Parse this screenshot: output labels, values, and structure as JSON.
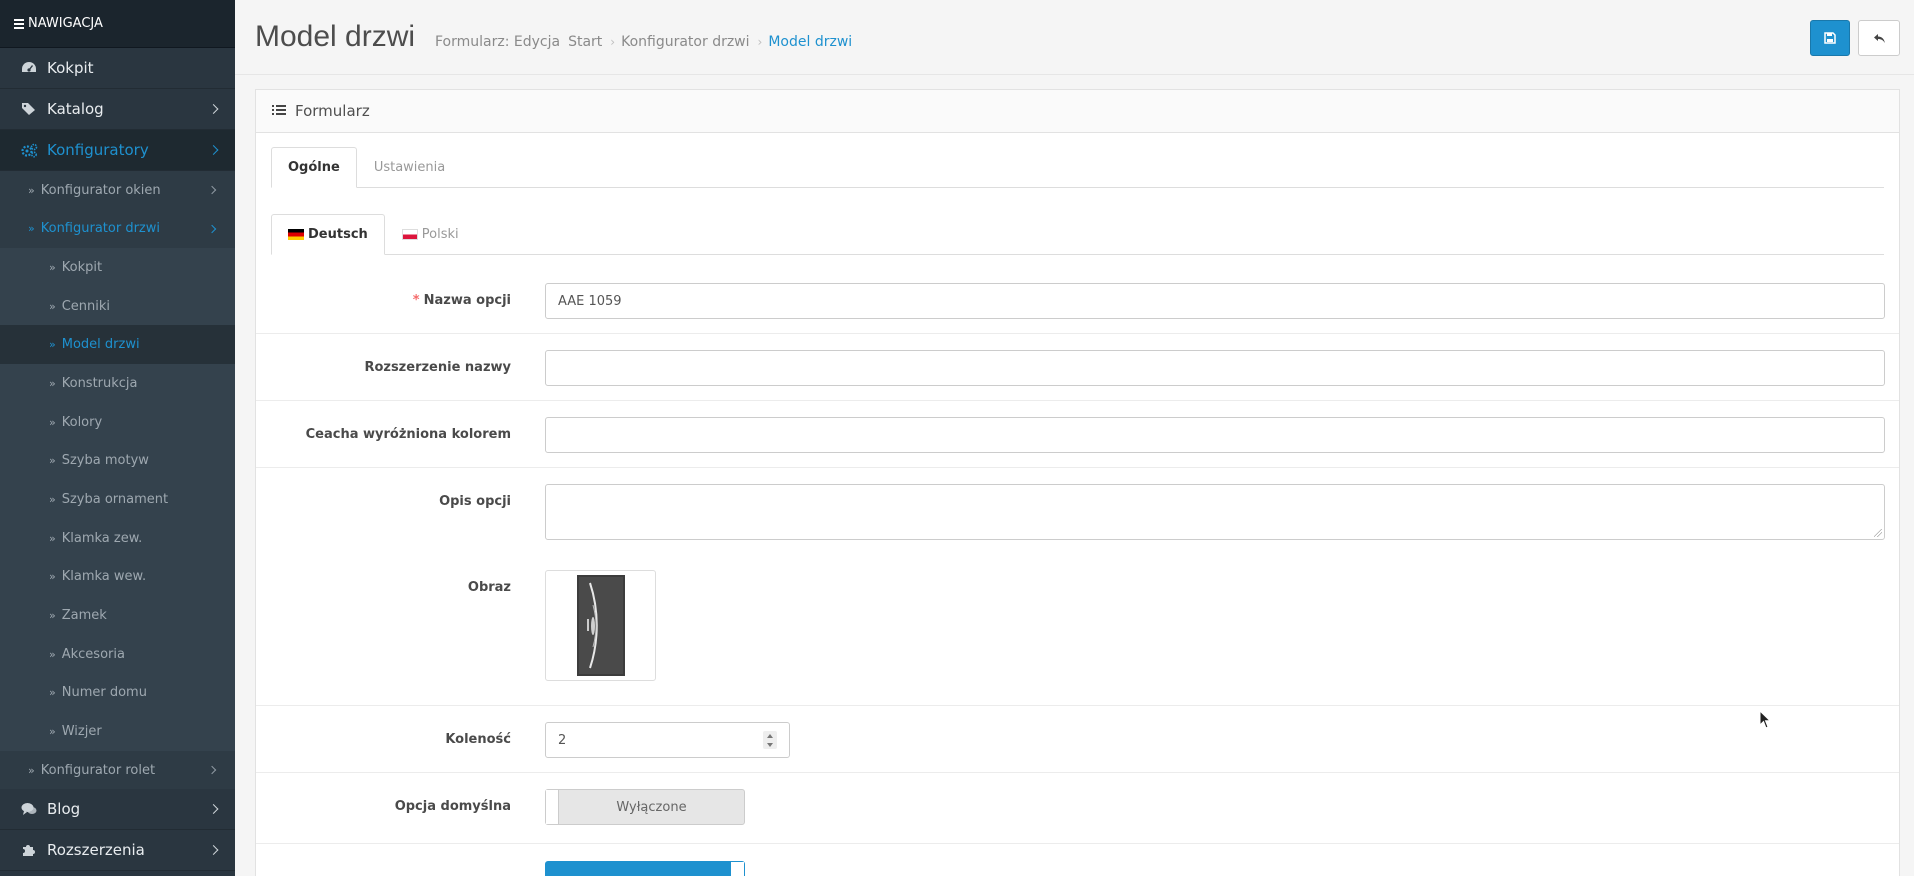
{
  "sidebar": {
    "header": "NAWIGACJA",
    "top_items": [
      {
        "label": "Kokpit",
        "icon": "dashboard-icon"
      },
      {
        "label": "Katalog",
        "icon": "tags-icon"
      },
      {
        "label": "Konfiguratory",
        "icon": "cogs-icon"
      }
    ],
    "sub_items": [
      {
        "label": "Konfigurator okien"
      },
      {
        "label": "Konfigurator drzwi"
      }
    ],
    "door_items": [
      {
        "label": "Kokpit"
      },
      {
        "label": "Cenniki"
      },
      {
        "label": "Model drzwi"
      },
      {
        "label": "Konstrukcja"
      },
      {
        "label": "Kolory"
      },
      {
        "label": "Szyba motyw"
      },
      {
        "label": "Szyba ornament"
      },
      {
        "label": "Klamka zew."
      },
      {
        "label": "Klamka wew."
      },
      {
        "label": "Zamek"
      },
      {
        "label": "Akcesoria"
      },
      {
        "label": "Numer domu"
      },
      {
        "label": "Wizjer"
      }
    ],
    "after_items": [
      {
        "label": "Konfigurator rolet"
      }
    ],
    "bottom_items": [
      {
        "label": "Blog",
        "icon": "comments-icon"
      },
      {
        "label": "Rozszerzenia",
        "icon": "puzzle-icon"
      }
    ]
  },
  "header": {
    "title": "Model drzwi",
    "breadcrumb": [
      "Formularz: Edycja",
      "Start",
      "Konfigurator drzwi",
      "Model drzwi"
    ],
    "save_icon": "save-icon",
    "back_icon": "reply-icon"
  },
  "panel": {
    "heading": "Formularz",
    "tabs": [
      "Ogólne",
      "Ustawienia"
    ],
    "lang_tabs": [
      "Deutsch",
      "Polski"
    ],
    "fields": {
      "option_name": {
        "label": "Nazwa opcji",
        "value": "AAE 1059"
      },
      "name_extension": {
        "label": "Rozszerzenie nazwy",
        "value": ""
      },
      "highlighted_feature": {
        "label": "Ceacha wyróżniona kolorem",
        "value": ""
      },
      "description": {
        "label": "Opis opcji",
        "value": ""
      },
      "image": {
        "label": "Obraz"
      },
      "order": {
        "label": "Koleność",
        "value": "2"
      },
      "default_option": {
        "label": "Opcja domyślna",
        "value": "Wyłączone"
      }
    }
  },
  "colors": {
    "accent": "#1e91cf",
    "sidebar": "#2a3640"
  }
}
